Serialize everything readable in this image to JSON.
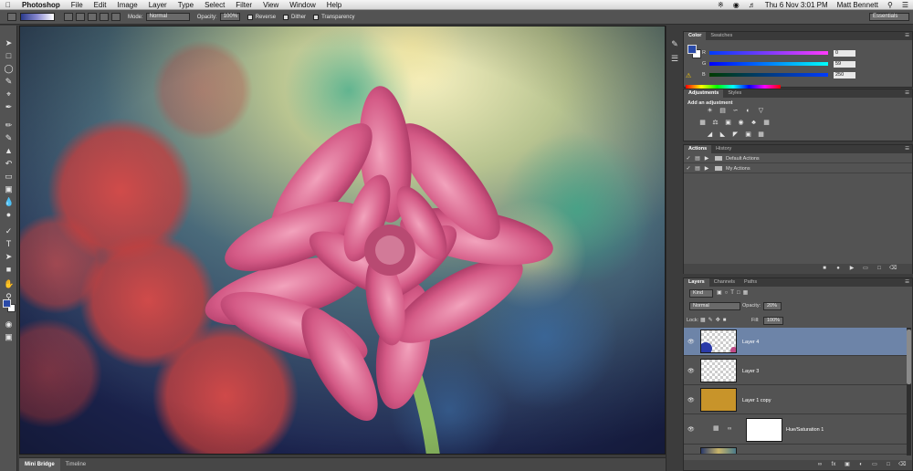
{
  "menubar": {
    "apple": "",
    "app_name": "Photoshop",
    "menus": [
      "File",
      "Edit",
      "Image",
      "Layer",
      "Type",
      "Select",
      "Filter",
      "View",
      "Window",
      "Help"
    ],
    "clock": "Thu 6 Nov  3:01 PM",
    "user": "Matt Bennett"
  },
  "options_bar": {
    "mode_label": "Mode:",
    "mode_value": "Normal",
    "opacity_label": "Opacity:",
    "opacity_value": "100%",
    "reverse_label": "Reverse",
    "dither_label": "Dither",
    "transparency_label": "Transparency",
    "workspace": "Essentials"
  },
  "color_panel": {
    "tabs": [
      "Color",
      "Swatches"
    ],
    "channels": [
      {
        "label": "R",
        "value": "0"
      },
      {
        "label": "G",
        "value": "59"
      },
      {
        "label": "B",
        "value": "250"
      }
    ],
    "foreground": "#2a4aa8"
  },
  "adjustments_panel": {
    "tabs": [
      "Adjustments",
      "Styles"
    ],
    "title": "Add an adjustment"
  },
  "actions_panel": {
    "tabs": [
      "Actions",
      "History"
    ],
    "items": [
      {
        "label": "Default Actions"
      },
      {
        "label": "My Actions"
      }
    ]
  },
  "layers_panel": {
    "tabs": [
      "Layers",
      "Channels",
      "Paths"
    ],
    "filter_label": "Kind",
    "blend_mode": "Normal",
    "opacity_label": "Opacity:",
    "opacity_value": "20%",
    "lock_label": "Lock:",
    "fill_label": "Fill:",
    "fill_value": "100%",
    "layers": [
      {
        "name": "Layer 4",
        "selected": true
      },
      {
        "name": "Layer 3",
        "selected": false
      },
      {
        "name": "Layer 1 copy",
        "selected": false
      },
      {
        "name": "Hue/Saturation 1",
        "selected": false
      }
    ]
  },
  "bottom_tabs": [
    "Mini Bridge",
    "Timeline"
  ]
}
